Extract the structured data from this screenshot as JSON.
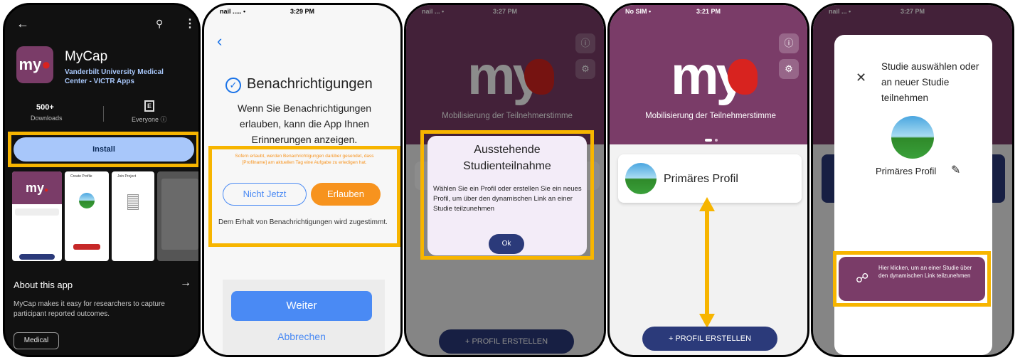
{
  "p1": {
    "app_name": "MyCap",
    "developer": "Vanderbilt University Medical Center - VICTR Apps",
    "logo_text": "my",
    "downloads_value": "500+",
    "downloads_label": "Downloads",
    "rating_label": "Everyone ⓘ",
    "install_label": "Install",
    "about_title": "About this app",
    "about_text": "MyCap makes it easy for researchers to capture participant reported outcomes.",
    "tag": "Medical",
    "shot_labels": [
      "Create Profile",
      "Join Project"
    ]
  },
  "p2": {
    "status_left": "nail ..... •",
    "time": "3:29 PM",
    "title": "Benachrichtigungen",
    "body": "Wenn Sie Benachrichtigungen erlauben, kann die App Ihnen Erinnerungen anzeigen.",
    "note": "Sofern erlaubt, werden Benachrichtigungen darüber gesendet, dass [Profilname] am aktuellen Tag eine Aufgabe zu erledigen hat.",
    "btn_no": "Nicht Jetzt",
    "btn_yes": "Erlauben",
    "consent": "Dem Erhalt von Benachrichtigungen wird zugestimmt.",
    "next": "Weiter",
    "cancel": "Abbrechen"
  },
  "p3": {
    "status_left": "nail ... •",
    "time": "3:27 PM",
    "logo_text": "my",
    "tagline": "Mobilisierung der Teilnehmerstimme",
    "dialog_title": "Ausstehende Studienteilnahme",
    "dialog_body": "Wählen Sie ein Profil oder erstellen Sie ein neues Profil, um über den dynamischen Link an einer Studie teilzunehmen",
    "ok": "Ok",
    "create": "+ PROFIL ERSTELLEN"
  },
  "p4": {
    "status_left": "No SIM •",
    "time": "3:21 PM",
    "logo_text": "my",
    "tagline": "Mobilisierung der Teilnehmerstimme",
    "profile": "Primäres Profil",
    "create": "+ PROFIL ERSTELLEN"
  },
  "p5": {
    "status_left": "nail ... •",
    "time": "3:27 PM",
    "title": "Studie auswählen oder an neuer Studie teilnehmen",
    "profile": "Primäres Profil",
    "link_btn": "Hier klicken, um an einer Studie über den dynamischen Link teilzunehmen"
  },
  "colors": {
    "highlight": "#f7b500",
    "brand": "#7a3c68",
    "install": "#a8c7fa",
    "allow": "#f7931e",
    "next": "#4a8af4",
    "navy": "#2b3a7a"
  }
}
